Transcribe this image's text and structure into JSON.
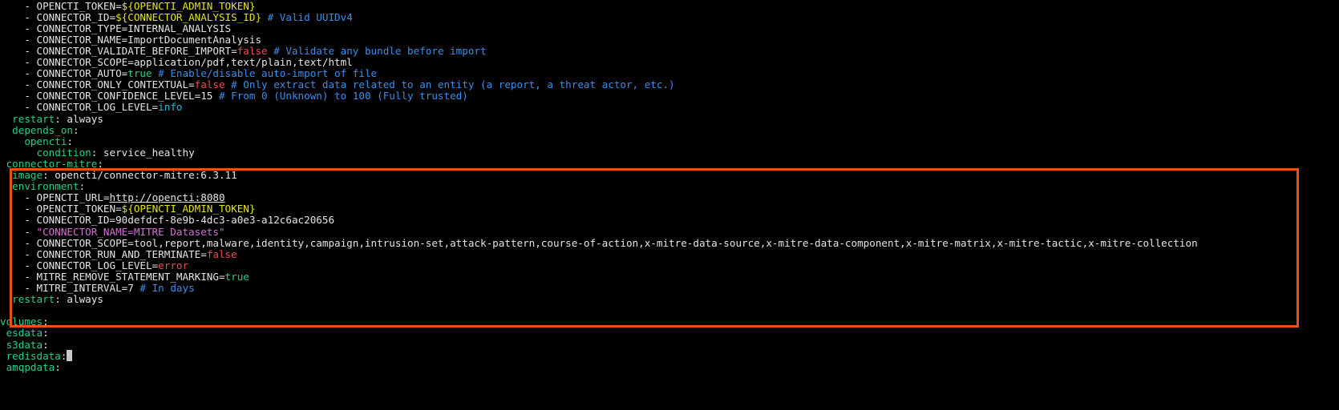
{
  "lines": [
    [
      {
        "t": "    - ",
        "c": "dash"
      },
      {
        "t": "OPENCTI_TOKEN=",
        "c": "default"
      },
      {
        "t": "${OPENCTI_ADMIN_TOKEN}",
        "c": "var"
      }
    ],
    [
      {
        "t": "    - ",
        "c": "dash"
      },
      {
        "t": "CONNECTOR_ID=",
        "c": "default"
      },
      {
        "t": "${CONNECTOR_ANALYSIS_ID}",
        "c": "var"
      },
      {
        "t": " # Valid UUIDv4",
        "c": "comment"
      }
    ],
    [
      {
        "t": "    - ",
        "c": "dash"
      },
      {
        "t": "CONNECTOR_TYPE=INTERNAL_ANALYSIS",
        "c": "default"
      }
    ],
    [
      {
        "t": "    - ",
        "c": "dash"
      },
      {
        "t": "CONNECTOR_NAME=ImportDocumentAnalysis",
        "c": "default"
      }
    ],
    [
      {
        "t": "    - ",
        "c": "dash"
      },
      {
        "t": "CONNECTOR_VALIDATE_BEFORE_IMPORT=",
        "c": "default"
      },
      {
        "t": "false",
        "c": "false"
      },
      {
        "t": " # Validate any bundle before import",
        "c": "comment"
      }
    ],
    [
      {
        "t": "    - ",
        "c": "dash"
      },
      {
        "t": "CONNECTOR_SCOPE=application/pdf,text/plain,text/html",
        "c": "default"
      }
    ],
    [
      {
        "t": "    - ",
        "c": "dash"
      },
      {
        "t": "CONNECTOR_AUTO=",
        "c": "default"
      },
      {
        "t": "true",
        "c": "true"
      },
      {
        "t": " # Enable/disable auto-import of file",
        "c": "comment"
      }
    ],
    [
      {
        "t": "    - ",
        "c": "dash"
      },
      {
        "t": "CONNECTOR_ONLY_CONTEXTUAL=",
        "c": "default"
      },
      {
        "t": "false",
        "c": "false"
      },
      {
        "t": " # Only extract data related to an entity (a report, a threat actor, etc.)",
        "c": "comment"
      }
    ],
    [
      {
        "t": "    - ",
        "c": "dash"
      },
      {
        "t": "CONNECTOR_CONFIDENCE_LEVEL=15",
        "c": "default"
      },
      {
        "t": " # From 0 (Unknown) to 100 (Fully trusted)",
        "c": "comment"
      }
    ],
    [
      {
        "t": "    - ",
        "c": "dash"
      },
      {
        "t": "CONNECTOR_LOG_LEVEL=",
        "c": "default"
      },
      {
        "t": "info",
        "c": "info"
      }
    ],
    [
      {
        "t": "  ",
        "c": "default"
      },
      {
        "t": "restart",
        "c": "key"
      },
      {
        "t": ": always",
        "c": "default"
      }
    ],
    [
      {
        "t": "  ",
        "c": "default"
      },
      {
        "t": "depends_on",
        "c": "key"
      },
      {
        "t": ":",
        "c": "default"
      }
    ],
    [
      {
        "t": "    ",
        "c": "default"
      },
      {
        "t": "opencti",
        "c": "key"
      },
      {
        "t": ":",
        "c": "default"
      }
    ],
    [
      {
        "t": "      ",
        "c": "default"
      },
      {
        "t": "condition",
        "c": "key"
      },
      {
        "t": ": service_healthy",
        "c": "default"
      }
    ],
    [
      {
        "t": " ",
        "c": "default"
      },
      {
        "t": "connector-mitre",
        "c": "key"
      },
      {
        "t": ":",
        "c": "default"
      }
    ],
    [
      {
        "t": "  ",
        "c": "default"
      },
      {
        "t": "image",
        "c": "key"
      },
      {
        "t": ": opencti/connector-mitre:6.3.11",
        "c": "default"
      }
    ],
    [
      {
        "t": "  ",
        "c": "default"
      },
      {
        "t": "environment",
        "c": "key"
      },
      {
        "t": ":",
        "c": "default"
      }
    ],
    [
      {
        "t": "    - ",
        "c": "dash"
      },
      {
        "t": "OPENCTI_URL=",
        "c": "default"
      },
      {
        "t": "http://opencti:8080",
        "c": "url"
      }
    ],
    [
      {
        "t": "    - ",
        "c": "dash"
      },
      {
        "t": "OPENCTI_TOKEN=",
        "c": "default"
      },
      {
        "t": "${OPENCTI_ADMIN_TOKEN}",
        "c": "var"
      }
    ],
    [
      {
        "t": "    - ",
        "c": "dash"
      },
      {
        "t": "CONNECTOR_ID=90defdcf-8e9b-4dc3-a0e3-a12c6ac20656",
        "c": "default"
      }
    ],
    [
      {
        "t": "    - ",
        "c": "dash"
      },
      {
        "t": "\"CONNECTOR_NAME=MITRE Datasets\"",
        "c": "string"
      }
    ],
    [
      {
        "t": "    - ",
        "c": "dash"
      },
      {
        "t": "CONNECTOR_SCOPE=tool,report,malware,identity,campaign,intrusion-set,attack-pattern,course-of-action,x-mitre-data-source,x-mitre-data-component,x-mitre-matrix,x-mitre-tactic,x-mitre-collection",
        "c": "default"
      }
    ],
    [
      {
        "t": "    - ",
        "c": "dash"
      },
      {
        "t": "CONNECTOR_RUN_AND_TERMINATE=",
        "c": "default"
      },
      {
        "t": "false",
        "c": "false"
      }
    ],
    [
      {
        "t": "    - ",
        "c": "dash"
      },
      {
        "t": "CONNECTOR_LOG_LEVEL=",
        "c": "default"
      },
      {
        "t": "error",
        "c": "false"
      }
    ],
    [
      {
        "t": "    - ",
        "c": "dash"
      },
      {
        "t": "MITRE_REMOVE_STATEMENT_MARKING=",
        "c": "default"
      },
      {
        "t": "true",
        "c": "true"
      }
    ],
    [
      {
        "t": "    - ",
        "c": "dash"
      },
      {
        "t": "MITRE_INTERVAL=7",
        "c": "default"
      },
      {
        "t": " # In days",
        "c": "comment"
      }
    ],
    [
      {
        "t": "  ",
        "c": "default"
      },
      {
        "t": "restart",
        "c": "key"
      },
      {
        "t": ": always",
        "c": "default"
      }
    ],
    [
      {
        "t": "",
        "c": "default"
      }
    ],
    [
      {
        "t": "volumes",
        "c": "key"
      },
      {
        "t": ":",
        "c": "default"
      }
    ],
    [
      {
        "t": " ",
        "c": "default"
      },
      {
        "t": "esdata",
        "c": "key"
      },
      {
        "t": ":",
        "c": "default"
      }
    ],
    [
      {
        "t": " ",
        "c": "default"
      },
      {
        "t": "s3data",
        "c": "key"
      },
      {
        "t": ":",
        "c": "default"
      }
    ],
    [
      {
        "t": " ",
        "c": "default"
      },
      {
        "t": "redisdata",
        "c": "key"
      },
      {
        "t": ":",
        "c": "default"
      }
    ],
    [
      {
        "t": " ",
        "c": "default"
      },
      {
        "t": "amqpdata",
        "c": "key"
      },
      {
        "t": ":",
        "c": "default"
      }
    ]
  ]
}
